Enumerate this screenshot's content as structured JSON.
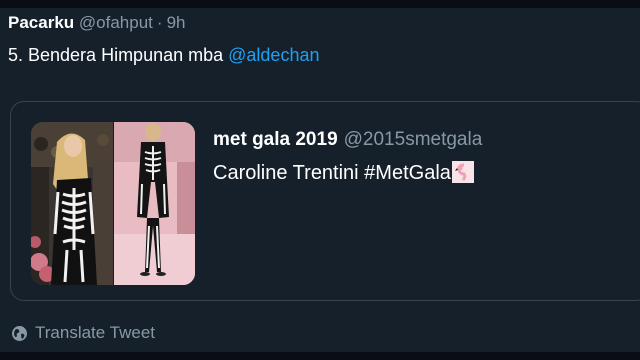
{
  "tweet": {
    "display_name": "Pacarku",
    "handle": "@ofahput",
    "separator": "·",
    "time": "9h",
    "text": "5. Bendera Himpunan mba ",
    "mention": "@aldechan"
  },
  "quoted_tweet": {
    "display_name": "met gala 2019",
    "handle": "@2015smetgala",
    "text": "Caroline Trentini #MetGala"
  },
  "translate": {
    "label": "Translate Tweet",
    "icon": "globe-icon"
  },
  "colors": {
    "background": "#15202b",
    "primary_text": "#ffffff",
    "secondary_text": "#8899a6",
    "link": "#1da1f2",
    "border": "#38444d"
  }
}
